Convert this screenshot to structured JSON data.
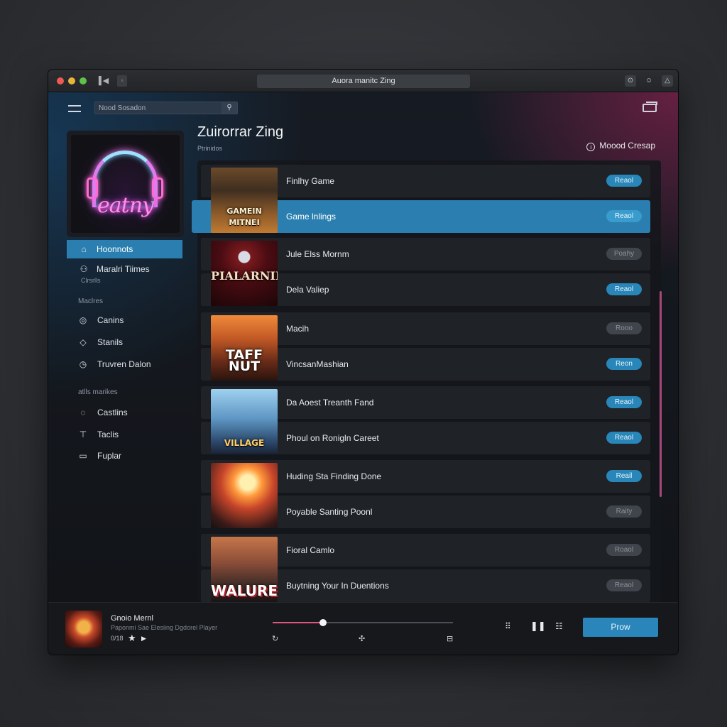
{
  "window": {
    "title": "Auora manitc Zing"
  },
  "search": {
    "placeholder": "Nood Sosadon"
  },
  "header": {
    "title": "Zuirorrar Zing",
    "subtitle": "Ptrinidos",
    "mood_label": "Moood Cresap"
  },
  "sidebar": {
    "album_art_text": "eatny",
    "nav": [
      {
        "label": "Hoonnots",
        "icon": "home-icon",
        "active": true
      },
      {
        "label": "Maralri Tiimes",
        "icon": "people-icon",
        "sub": "Clrsrlls"
      }
    ],
    "section1": {
      "label": "Maclres",
      "items": [
        {
          "label": "Canins",
          "icon": "circle-check-icon"
        },
        {
          "label": "Stanils",
          "icon": "stack-icon"
        },
        {
          "label": "Truvren Dalon",
          "icon": "clock-icon"
        }
      ]
    },
    "section2": {
      "label": "atlls marikes",
      "items": [
        {
          "label": "Castlins",
          "icon": "chat-icon"
        },
        {
          "label": "Taclis",
          "icon": "tag-icon"
        },
        {
          "label": "Fuplar",
          "icon": "folder-icon"
        }
      ]
    }
  },
  "list": {
    "groups": [
      {
        "cover_text": "GAMEIN MITNEI",
        "rows": [
          {
            "title": "Finlhy Game",
            "pill": "Reaol",
            "pill_state": "on",
            "selected": false
          },
          {
            "title": "Game lnlings",
            "pill": "Reaol",
            "pill_state": "on",
            "selected": true
          }
        ]
      },
      {
        "cover_text": "PIALARNINS",
        "rows": [
          {
            "title": "Jule Elss Mornm",
            "pill": "Poahy",
            "pill_state": "off",
            "selected": false
          },
          {
            "title": "Dela Valiep",
            "pill": "Reaol",
            "pill_state": "on",
            "selected": false
          }
        ]
      },
      {
        "cover_text": "TAFF NUT",
        "rows": [
          {
            "title": "Macih",
            "pill": "Rooo",
            "pill_state": "off",
            "selected": false
          },
          {
            "title": "VincsanMashian",
            "pill": "Reon",
            "pill_state": "on",
            "selected": false
          }
        ]
      },
      {
        "cover_text": "VILLAGE",
        "rows": [
          {
            "title": "Da Aoest Treanth Fand",
            "pill": "Reaol",
            "pill_state": "on",
            "selected": false
          },
          {
            "title": "Phoul on Ronigln Careet",
            "pill": "Reaol",
            "pill_state": "on",
            "selected": false
          }
        ]
      },
      {
        "cover_text": "",
        "rows": [
          {
            "title": "Huding Sta Finding Done",
            "pill": "Reail",
            "pill_state": "on",
            "selected": false
          },
          {
            "title": "Poyable Santing Poonl",
            "pill": "Raity",
            "pill_state": "off",
            "selected": false
          }
        ]
      },
      {
        "cover_text": "WALURE",
        "rows": [
          {
            "title": "Fioral Camlo",
            "pill": "Roaol",
            "pill_state": "off",
            "selected": false
          },
          {
            "title": "Buytning Your In Duentions",
            "pill": "Reaol",
            "pill_state": "off",
            "selected": false
          }
        ]
      }
    ]
  },
  "player": {
    "track_title": "Gnoio Mernl",
    "track_sub": "Paponmi Sae Elesiing Dgdorel Player",
    "time": "0/18",
    "progress": 0.28,
    "play_button_label": "Prow"
  },
  "colors": {
    "accent": "#2a7fb0",
    "pill_on": "#2886b8",
    "progress": "#e2557e",
    "glow": "#a8245c"
  }
}
